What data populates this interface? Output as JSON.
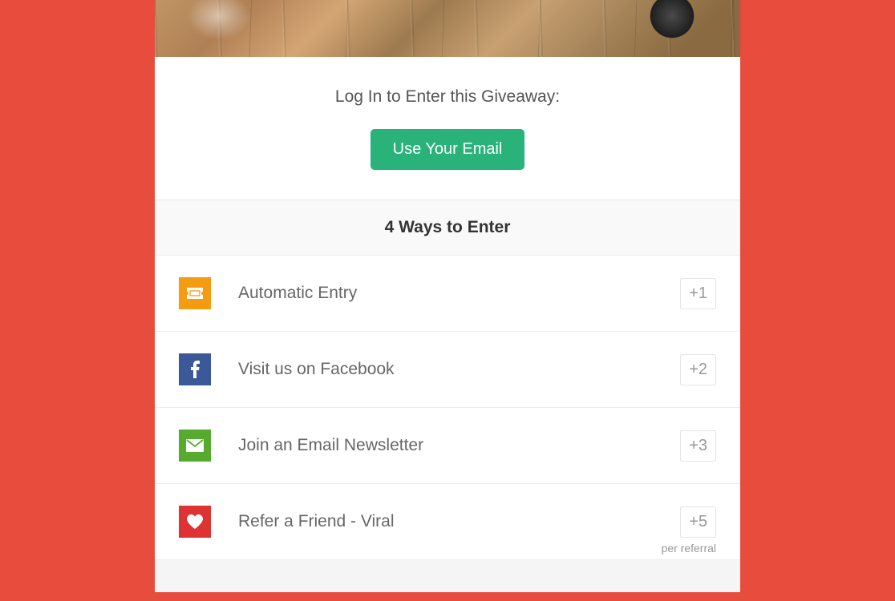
{
  "login": {
    "prompt": "Log In to Enter this Giveaway:",
    "button_label": "Use Your Email"
  },
  "ways_header": "4 Ways to Enter",
  "entries": [
    {
      "icon": "ticket-icon",
      "icon_color": "orange",
      "label": "Automatic Entry",
      "points": "+1",
      "sublabel": null
    },
    {
      "icon": "facebook-icon",
      "icon_color": "blue",
      "label": "Visit us on Facebook",
      "points": "+2",
      "sublabel": null
    },
    {
      "icon": "envelope-icon",
      "icon_color": "green",
      "label": "Join an Email Newsletter",
      "points": "+3",
      "sublabel": null
    },
    {
      "icon": "heart-icon",
      "icon_color": "red",
      "label": "Refer a Friend - Viral",
      "points": "+5",
      "sublabel": "per referral"
    }
  ]
}
